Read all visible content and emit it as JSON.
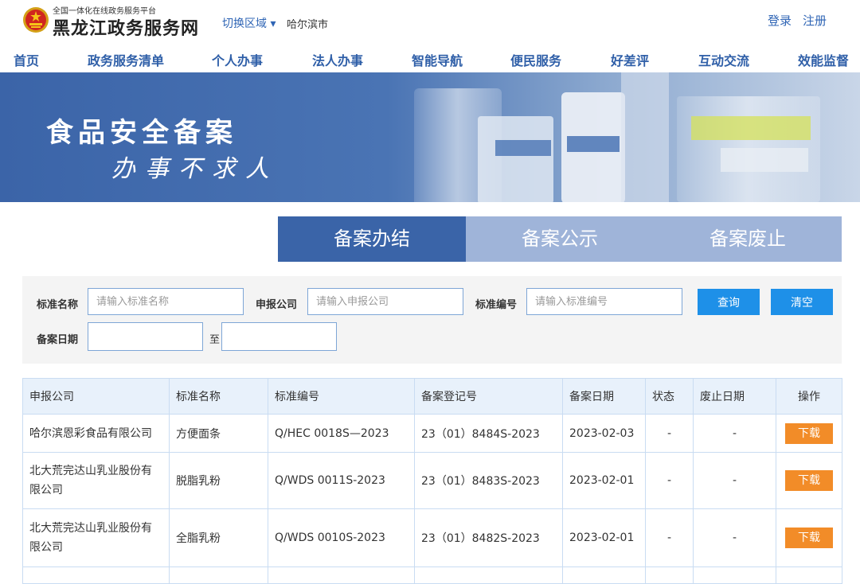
{
  "header": {
    "portal_subtitle": "全国一体化在线政务服务平台",
    "portal_name": "黑龙江政务服务网",
    "region_switch": "切换区域 ▾",
    "current_region": "哈尔滨市",
    "login": "登录",
    "register": "注册"
  },
  "nav": {
    "items": [
      "首页",
      "政务服务清单",
      "个人办事",
      "法人办事",
      "智能导航",
      "便民服务",
      "好差评",
      "互动交流",
      "效能监督"
    ]
  },
  "banner": {
    "title": "食品安全备案",
    "slogan": "办事不求人"
  },
  "tabs": [
    {
      "label": "备案办结",
      "active": true
    },
    {
      "label": "备案公示",
      "active": false
    },
    {
      "label": "备案废止",
      "active": false
    }
  ],
  "search": {
    "standard_name_label": "标准名称",
    "standard_name_placeholder": "请输入标准名称",
    "company_label": "申报公司",
    "company_placeholder": "请输入申报公司",
    "standard_no_label": "标准编号",
    "standard_no_placeholder": "请输入标准编号",
    "date_label": "备案日期",
    "to_label": "至",
    "query_button": "查询",
    "clear_button": "清空"
  },
  "table": {
    "headers": [
      "申报公司",
      "标准名称",
      "标准编号",
      "备案登记号",
      "备案日期",
      "状态",
      "废止日期",
      "操作"
    ],
    "rows": [
      {
        "company": "哈尔滨恩彩食品有限公司",
        "name": "方便面条",
        "standard_no": "Q/HEC 0018S—2023",
        "reg_no": "23（01）8484S-2023",
        "date": "2023-02-03",
        "status": "-",
        "abolish_date": "-",
        "action": "下载"
      },
      {
        "company": "北大荒完达山乳业股份有限公司",
        "name": "脱脂乳粉",
        "standard_no": "Q/WDS 0011S-2023",
        "reg_no": "23（01）8483S-2023",
        "date": "2023-02-01",
        "status": "-",
        "abolish_date": "-",
        "action": "下载"
      },
      {
        "company": "北大荒完达山乳业股份有限公司",
        "name": "全脂乳粉",
        "standard_no": "Q/WDS 0010S-2023",
        "reg_no": "23（01）8482S-2023",
        "date": "2023-02-01",
        "status": "-",
        "abolish_date": "-",
        "action": "下载"
      }
    ]
  },
  "colors": {
    "nav_text": "#2f5fa8",
    "tab_active": "#3a64a8",
    "tab_inactive": "#9fb4d9",
    "button_blue": "#1e90e8",
    "download_orange": "#f28c28",
    "table_header_bg": "#e8f1fb"
  }
}
